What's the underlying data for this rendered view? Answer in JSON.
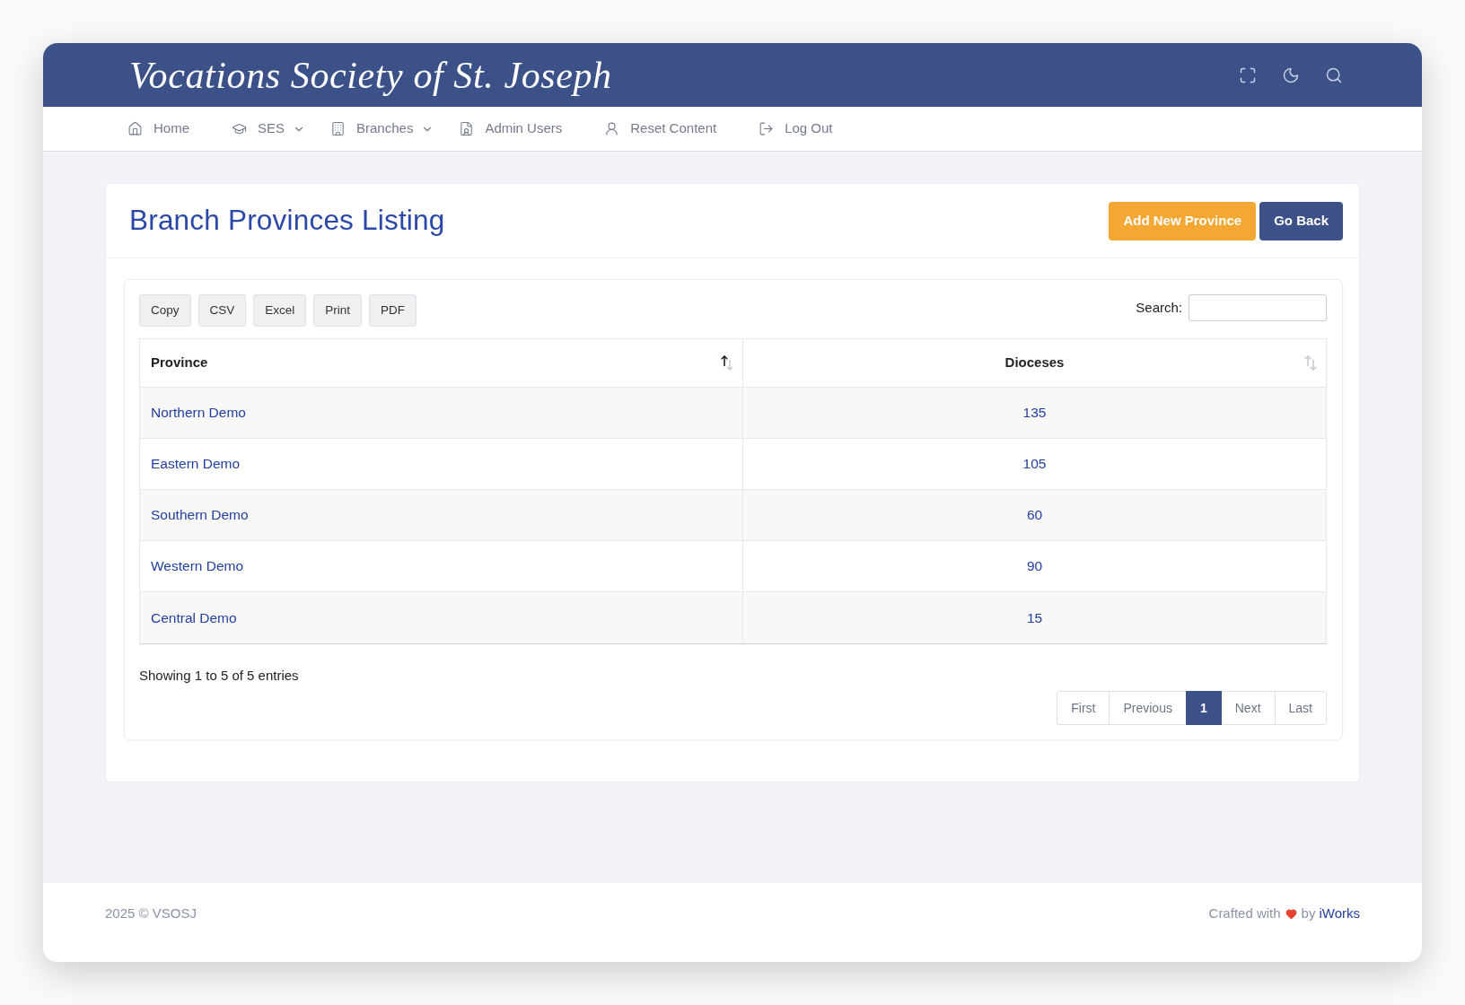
{
  "header": {
    "title": "Vocations Society of St. Joseph"
  },
  "nav": {
    "items": [
      {
        "label": "Home",
        "dropdown": false
      },
      {
        "label": "SES",
        "dropdown": true
      },
      {
        "label": "Branches",
        "dropdown": true
      },
      {
        "label": "Admin Users",
        "dropdown": false
      },
      {
        "label": "Reset Content",
        "dropdown": false
      },
      {
        "label": "Log Out",
        "dropdown": false
      }
    ]
  },
  "page": {
    "title": "Branch Provinces Listing",
    "actions": [
      {
        "label": "Add New Province",
        "kind": "warning"
      },
      {
        "label": "Go Back",
        "kind": "primary"
      }
    ]
  },
  "table_tools": {
    "buttons": [
      "Copy",
      "CSV",
      "Excel",
      "Print",
      "PDF"
    ],
    "search": {
      "label": "Search:"
    }
  },
  "table": {
    "columns": [
      {
        "label": "Province",
        "sorted": true
      },
      {
        "label": "Dioceses",
        "sorted": false
      }
    ],
    "rows": [
      {
        "province": "Northern Demo",
        "dioceses": "135"
      },
      {
        "province": "Eastern Demo",
        "dioceses": "105"
      },
      {
        "province": "Southern Demo",
        "dioceses": "60"
      },
      {
        "province": "Western Demo",
        "dioceses": "90"
      },
      {
        "province": "Central Demo",
        "dioceses": "15"
      }
    ]
  },
  "table_info": "Showing 1 to 5 of 5 entries",
  "pagination": [
    {
      "label": "First",
      "selected": false
    },
    {
      "label": "Previous",
      "selected": false
    },
    {
      "label": "1",
      "selected": true
    },
    {
      "label": "Next",
      "selected": false
    },
    {
      "label": "Last",
      "selected": false
    }
  ],
  "footer": {
    "copyright": "2025 © VSOSJ",
    "credit": "Crafted with",
    "credit_by": "by",
    "credit_link": "iWorks"
  }
}
